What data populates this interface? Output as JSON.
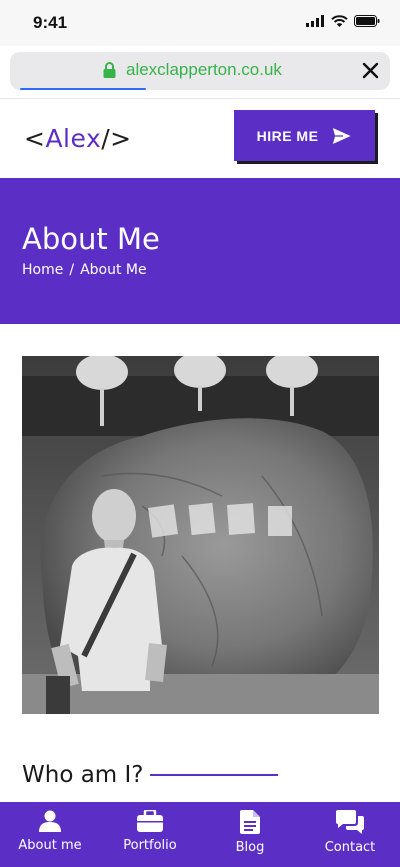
{
  "status": {
    "time": "9:41"
  },
  "browser": {
    "url": "alexclapperton.co.uk",
    "load_progress": 0.35
  },
  "header": {
    "logo_open": "<",
    "logo_name": "Alex",
    "logo_close": "/>",
    "hire_label": "HIRE ME"
  },
  "hero": {
    "title": "About Me",
    "breadcrumb_home": "Home",
    "breadcrumb_sep": "/",
    "breadcrumb_current": "About Me"
  },
  "content": {
    "who_heading": "Who am I?"
  },
  "nav": {
    "items": [
      {
        "label": "About me",
        "icon": "user-icon"
      },
      {
        "label": "Portfolio",
        "icon": "briefcase-icon"
      },
      {
        "label": "Blog",
        "icon": "document-icon"
      },
      {
        "label": "Contact",
        "icon": "chat-icon"
      }
    ]
  },
  "colors": {
    "brand": "#5b2fc6",
    "url_green": "#36b34a"
  }
}
